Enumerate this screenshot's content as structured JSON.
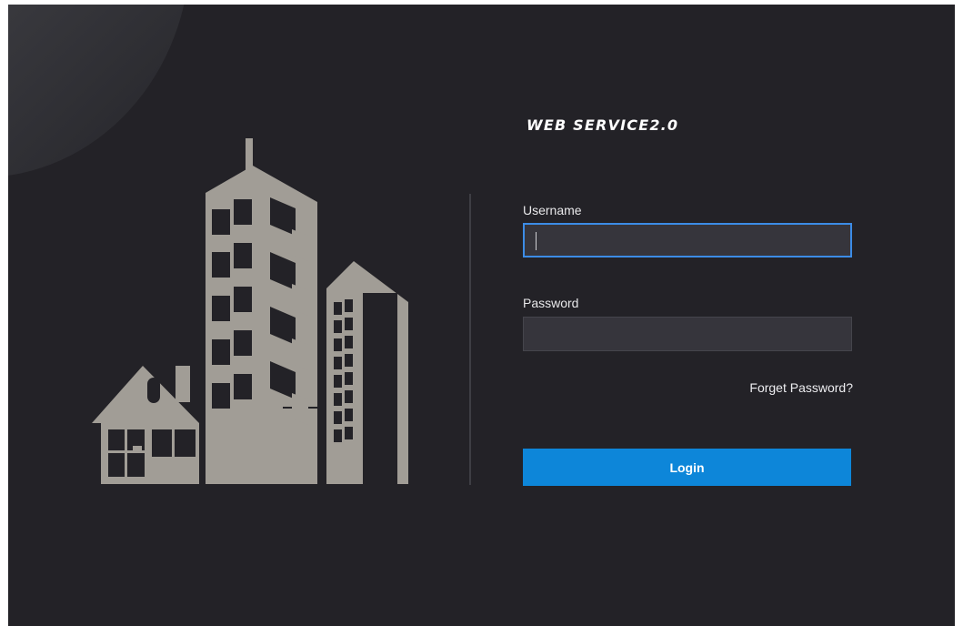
{
  "brand": {
    "title": "WEB SERVICE2.0"
  },
  "login_form": {
    "username_label": "Username",
    "username_value": "",
    "password_label": "Password",
    "password_value": "",
    "forget_password": "Forget Password?",
    "login_button": "Login"
  },
  "illustration": {
    "icon": "buildings-house-icon",
    "color": "#a19d96"
  },
  "colors": {
    "background": "#232227",
    "input_background": "#36353c",
    "focus_border": "#3c8ce6",
    "button": "#0d86d9",
    "text": "#ffffff"
  }
}
